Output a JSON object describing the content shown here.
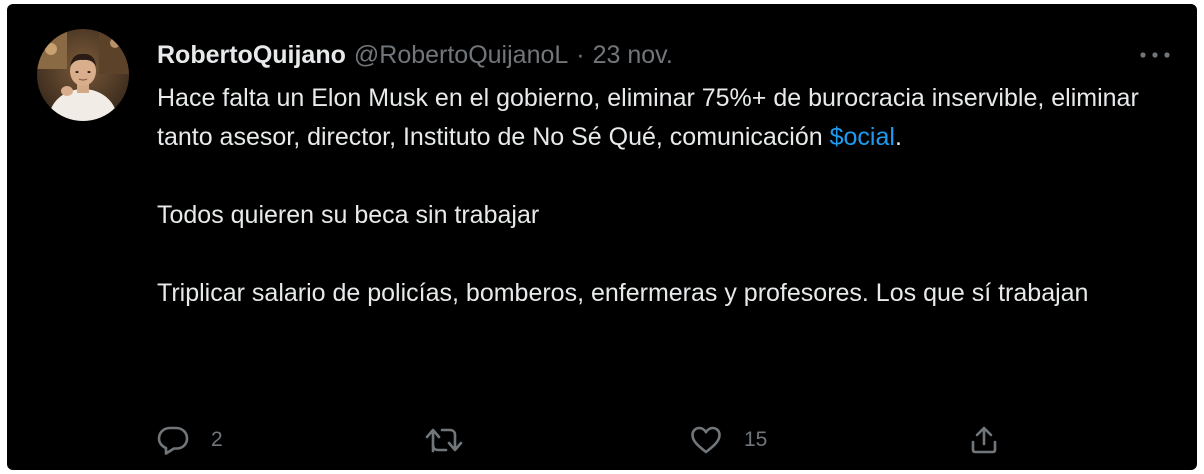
{
  "tweet": {
    "author": {
      "display_name": "RobertoQuijano",
      "handle": "@RobertoQuijanoL",
      "separator": "·",
      "date": "23 nov."
    },
    "text": {
      "line1_before_cashtag": "Hace falta un Elon Musk en el gobierno, eliminar 75%+ de burocracia inservible, eliminar tanto asesor, director, Instituto de No Sé Qué, comunicación ",
      "cashtag": "$ocial",
      "line1_after_cashtag": ".",
      "paragraph2": "Todos quieren su beca sin trabajar",
      "paragraph3": "Triplicar salario de policías, bomberos, enfermeras y profesores. Los que sí trabajan"
    },
    "actions": {
      "reply_count": "2",
      "retweet_count": "",
      "like_count": "15"
    },
    "icons": {
      "avatar": "avatar",
      "more": "more-icon",
      "reply": "reply-icon",
      "retweet": "retweet-icon",
      "like": "like-icon",
      "share": "share-icon"
    },
    "colors": {
      "background": "#000000",
      "text": "#e7e9ea",
      "secondary": "#71767b",
      "link": "#1d9bf0"
    }
  }
}
